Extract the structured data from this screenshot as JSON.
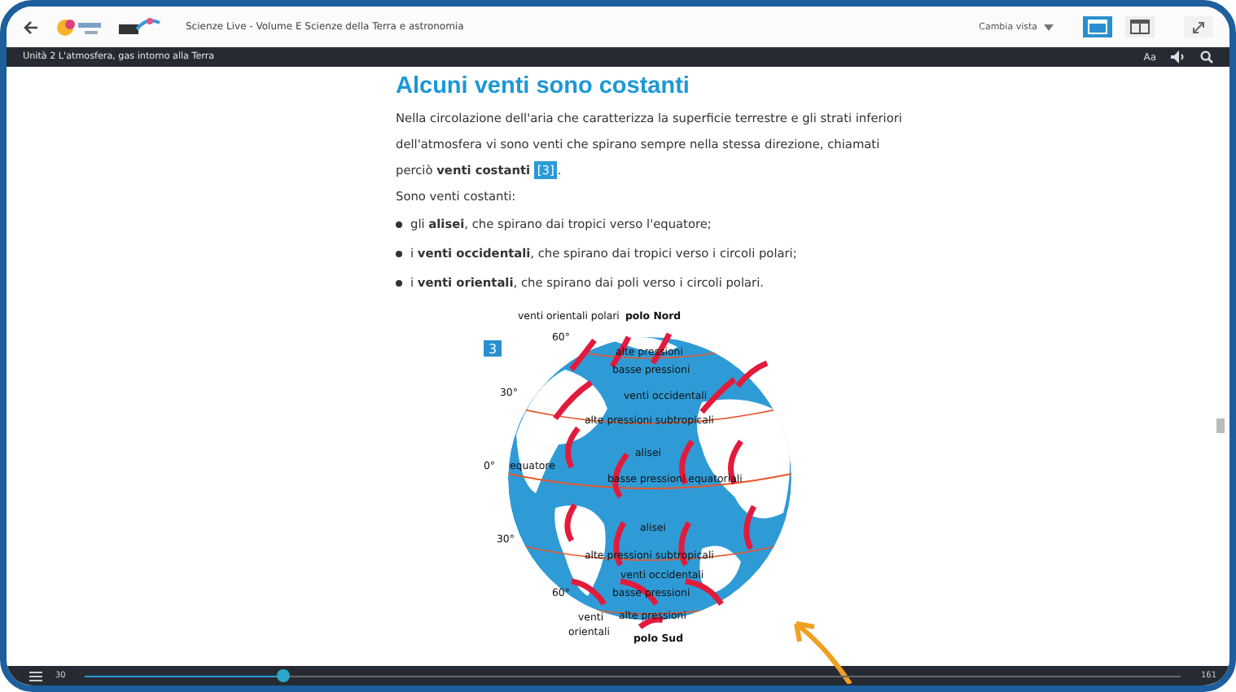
{
  "topbar": {
    "title": "Scienze Live - Volume E Scienze della Terra e astronomia",
    "view_menu": "Cambia vista",
    "views": [
      {
        "selected": true
      },
      {
        "selected": false
      }
    ]
  },
  "chapter_bar": {
    "title": "Unità 2 L'atmosfera, gas intorno alla Terra",
    "font_button": "Aa"
  },
  "content": {
    "heading": "Alcuni venti sono costanti",
    "paragraph": {
      "text": "Nella circolazione dell'aria che caratterizza la superficie terrestre e gli strati inferiori dell'atmosfera vi sono venti che spirano sempre nella stessa direzione, chiamati perciò **venti costanti**",
      "ref": "[3]",
      "after": "."
    },
    "intro": "Sono venti costanti:",
    "bullets": [
      "gli **alisei**, che spirano dai tropici verso l'equatore;",
      "i **venti occidentali**, che spirano dai tropici verso i circoli polari;",
      "i **venti orientali**, che spirano dai poli verso i circoli polari."
    ],
    "figure": {
      "number": "3",
      "labels": [
        {
          "text": "venti orientali polari",
          "bold": false
        },
        {
          "text": "polo Nord",
          "bold": true
        },
        {
          "text": "60°",
          "bold": false
        },
        {
          "text": "alte pressioni",
          "bold": false
        },
        {
          "text": "basse pressioni",
          "bold": false
        },
        {
          "text": "30°",
          "bold": false
        },
        {
          "text": "venti occidentali",
          "bold": false
        },
        {
          "text": "alte pressioni subtropicali",
          "bold": false
        },
        {
          "text": "alisei",
          "bold": false
        },
        {
          "text": "0°",
          "bold": false
        },
        {
          "text": "equatore",
          "bold": false
        },
        {
          "text": "basse pressioni equatoriali",
          "bold": false
        },
        {
          "text": "alisei",
          "bold": false
        },
        {
          "text": "30°",
          "bold": false
        },
        {
          "text": "alte pressioni subtropicali",
          "bold": false
        },
        {
          "text": "venti occidentali",
          "bold": false
        },
        {
          "text": "60°",
          "bold": false
        },
        {
          "text": "basse pressioni",
          "bold": false
        },
        {
          "text": "venti",
          "bold": false
        },
        {
          "text": "orientali",
          "bold": false
        },
        {
          "text": "alte pressioni",
          "bold": false
        },
        {
          "text": "polo Sud",
          "bold": true
        }
      ]
    }
  },
  "pager": {
    "current": "30",
    "total": "161",
    "level": 0.18
  }
}
